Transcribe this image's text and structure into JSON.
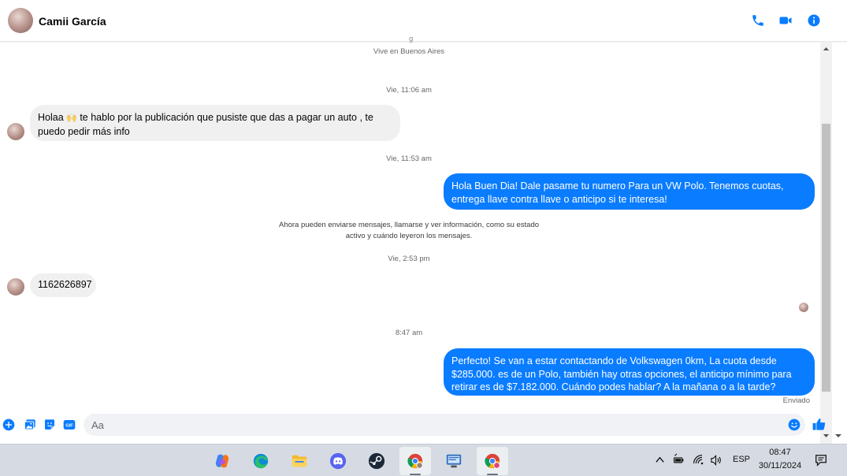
{
  "contact": {
    "name": "Camii García"
  },
  "info": {
    "partial_above": "g",
    "location": "Vive en Buenos Aires"
  },
  "timestamps": {
    "t1": "Vie, 11:06 am",
    "t2": "Vie, 11:53 am",
    "t3": "Vie, 2:53 pm",
    "t4": "8:47 am"
  },
  "messages": {
    "m1_pre": "Holaa",
    "m1_emoji": "🙌",
    "m1_post": " te hablo por la publicación que pusiste que das a pagar un auto , te puedo pedir más info",
    "m2": "Hola Buen Dia! Dale pasame tu numero Para un VW Polo. Tenemos cuotas, entrega llave contra llave o anticipo si te interesa!",
    "m3": "1162626897",
    "m4": "Perfecto!  Se van a estar contactando de Volkswagen 0km, La cuota desde $285.000. es de un Polo, también hay otras opciones, el anticipo mínimo para retirar es de $7.182.000. Cuándo podes hablar? A la mañana o a la tarde?"
  },
  "system_notice": "Ahora pueden enviarse mensajes, llamarse y ver información, como su estado activo y cuándo leyeron los mensajes.",
  "status": {
    "sent": "Enviado"
  },
  "composer": {
    "placeholder": "Aa"
  },
  "taskbar": {
    "language": "ESP",
    "time": "08:47",
    "date": "30/11/2024"
  },
  "colors": {
    "accent": "#0a7cff",
    "incoming": "#f0f0f0"
  }
}
